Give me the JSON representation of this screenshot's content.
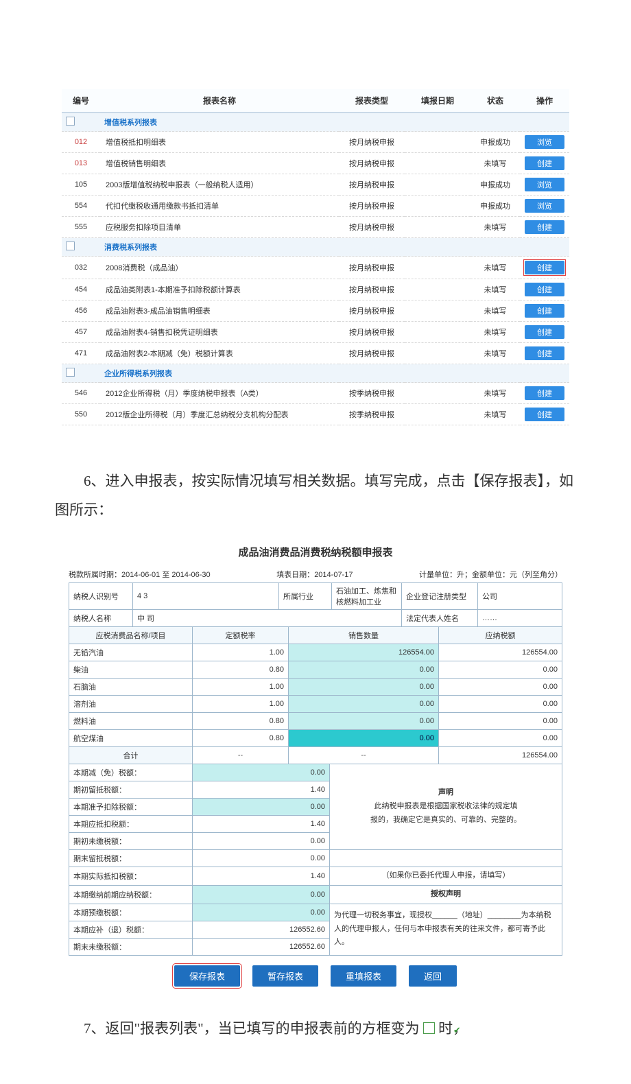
{
  "report_list": {
    "headers": {
      "code": "编号",
      "name": "报表名称",
      "type": "报表类型",
      "date": "填报日期",
      "status": "状态",
      "action": "操作"
    },
    "sections": [
      {
        "title": "增值税系列报表",
        "rows": [
          {
            "code": "012",
            "code_red": true,
            "name": "增值税抵扣明细表",
            "type": "按月纳税申报",
            "date": "",
            "status": "申报成功",
            "action": "浏览",
            "btn": "browse"
          },
          {
            "code": "013",
            "code_red": true,
            "name": "增值税销售明细表",
            "type": "按月纳税申报",
            "date": "",
            "status": "未填写",
            "action": "创建",
            "btn": "create"
          },
          {
            "code": "105",
            "name": "2003版增值税纳税申报表（一般纳税人适用）",
            "type": "按月纳税申报",
            "date": "",
            "status": "申报成功",
            "action": "浏览",
            "btn": "browse"
          },
          {
            "code": "554",
            "name": "代扣代缴税收通用缴款书抵扣清单",
            "type": "按月纳税申报",
            "date": "",
            "status": "申报成功",
            "action": "浏览",
            "btn": "browse"
          },
          {
            "code": "555",
            "name": "应税服务扣除项目清单",
            "type": "按月纳税申报",
            "date": "",
            "status": "未填写",
            "action": "创建",
            "btn": "create"
          }
        ]
      },
      {
        "title": "消费税系列报表",
        "rows": [
          {
            "code": "032",
            "name": "2008消费税（成品油）",
            "type": "按月纳税申报",
            "date": "",
            "status": "未填写",
            "action": "创建",
            "btn": "create",
            "highlight": true
          },
          {
            "code": "454",
            "name": "成品油类附表1-本期准予扣除税额计算表",
            "type": "按月纳税申报",
            "date": "",
            "status": "未填写",
            "action": "创建",
            "btn": "create"
          },
          {
            "code": "456",
            "name": "成品油附表3-成品油销售明细表",
            "type": "按月纳税申报",
            "date": "",
            "status": "未填写",
            "action": "创建",
            "btn": "create"
          },
          {
            "code": "457",
            "name": "成品油附表4-销售扣税凭证明细表",
            "type": "按月纳税申报",
            "date": "",
            "status": "未填写",
            "action": "创建",
            "btn": "create"
          },
          {
            "code": "471",
            "name": "成品油附表2-本期减（免）税额计算表",
            "type": "按月纳税申报",
            "date": "",
            "status": "未填写",
            "action": "创建",
            "btn": "create"
          }
        ]
      },
      {
        "title": "企业所得税系列报表",
        "rows": [
          {
            "code": "546",
            "name": "2012企业所得税（月）季度纳税申报表（A类）",
            "type": "按季纳税申报",
            "date": "",
            "status": "未填写",
            "action": "创建",
            "btn": "create"
          },
          {
            "code": "550",
            "name": "2012版企业所得税（月）季度汇总纳税分支机构分配表",
            "type": "按季纳税申报",
            "date": "",
            "status": "未填写",
            "action": "创建",
            "btn": "create"
          }
        ]
      }
    ]
  },
  "narr6": "6、进入申报表，按实际情况填写相关数据。填写完成，点击【保存报表】，如图所示：",
  "narr7_a": "7、返回\"报表列表\"，当已填写的申报表前的方框变为",
  "narr7_b": "时，",
  "tax_form": {
    "title": "成品油消费品消费税纳税额申报表",
    "period_lbl": "税款所属时期：",
    "period": "2014-06-01 至 2014-06-30",
    "fill_date_lbl": "填表日期：",
    "fill_date": "2014-07-17",
    "unit_lbl": "计量单位：升；金额单位：元（列至角分）",
    "id_lbl": "纳税人识别号",
    "id_val": "4              3",
    "industry_lbl": "所属行业",
    "industry_val": "石油加工、炼焦和核燃料加工业",
    "regtype_lbl": "企业登记注册类型",
    "regtype_val": "             公司",
    "payer_lbl": "纳税人名称",
    "payer_val": "中                      司",
    "legal_lbl": "法定代表人姓名",
    "legal_val": "  ……",
    "cols": {
      "item": "应税消费品名称/项目",
      "rate": "定额税率",
      "qty": "销售数量",
      "tax": "应纳税额"
    },
    "items": [
      {
        "name": "无铅汽油",
        "rate": "1.00",
        "qty": "126554.00",
        "tax": "126554.00"
      },
      {
        "name": "柴油",
        "rate": "0.80",
        "qty": "0.00",
        "tax": "0.00"
      },
      {
        "name": "石脑油",
        "rate": "1.00",
        "qty": "0.00",
        "tax": "0.00"
      },
      {
        "name": "溶剂油",
        "rate": "1.00",
        "qty": "0.00",
        "tax": "0.00"
      },
      {
        "name": "燃料油",
        "rate": "0.80",
        "qty": "0.00",
        "tax": "0.00"
      },
      {
        "name": "航空煤油",
        "rate": "0.80",
        "qty": "0.00",
        "tax": "0.00",
        "qty_hl": true
      }
    ],
    "total_lbl": "合计",
    "total_tax": "126554.00",
    "lower": [
      {
        "lbl": "本期减（免）税额：",
        "val": "0.00",
        "cyan": true
      },
      {
        "lbl": "期初留抵税额：",
        "val": "1.40"
      },
      {
        "lbl": "本期准予扣除税额：",
        "val": "0.00",
        "cyan": true
      },
      {
        "lbl": "本期应抵扣税额：",
        "val": "1.40"
      },
      {
        "lbl": "期初未缴税额：",
        "val": "0.00"
      },
      {
        "lbl": "期末留抵税额：",
        "val": "0.00"
      },
      {
        "lbl": "本期实际抵扣税额：",
        "val": "1.40"
      },
      {
        "lbl": "本期缴纳前期应纳税额：",
        "val": "0.00",
        "cyan": true
      },
      {
        "lbl": "本期预缴税额：",
        "val": "0.00",
        "cyan": true
      },
      {
        "lbl": "本期应补（退）税额：",
        "val": "126552.60"
      },
      {
        "lbl": "期末未缴税额：",
        "val": "126552.60"
      }
    ],
    "declare_title": "声明",
    "declare_body1": "此纳税申报表是根据国家税收法律的规定填",
    "declare_body2": "报的，我确定它是真实的、可靠的、完整的。",
    "agent_hint": "（如果你已委托代理人申报，请填写）",
    "agent_title": "授权声明",
    "agent_body": "为代理一切税务事宜，现授权______（地址）________为本纳税人的代理申报人，任何与本申报表有关的往来文件，都可寄予此人。",
    "buttons": {
      "save": "保存报表",
      "temp": "暂存报表",
      "refill": "重填报表",
      "back": "返回"
    }
  }
}
